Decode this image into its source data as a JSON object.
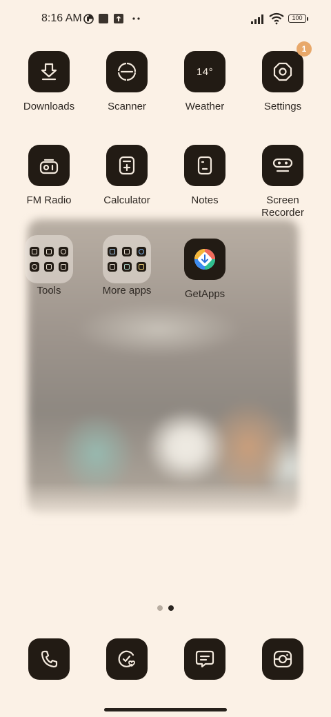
{
  "status_bar": {
    "time": "8:16 AM",
    "battery": "100",
    "icons": [
      "data-saver-icon",
      "square-notification-icon",
      "upload-notification-icon",
      "more-notifications-icon",
      "signal-icon",
      "wifi-icon",
      "battery-icon"
    ]
  },
  "home": {
    "row1": [
      {
        "label": "Downloads",
        "icon": "download-icon"
      },
      {
        "label": "Scanner",
        "icon": "scanner-icon"
      },
      {
        "label": "Weather",
        "icon": "weather-icon",
        "temp": "14°"
      },
      {
        "label": "Settings",
        "icon": "settings-icon",
        "badge": "1"
      }
    ],
    "row2": [
      {
        "label": "FM Radio",
        "icon": "radio-icon"
      },
      {
        "label": "Calculator",
        "icon": "calculator-icon"
      },
      {
        "label": "Notes",
        "icon": "notes-icon"
      },
      {
        "label": "Screen\nRecorder",
        "icon": "screen-recorder-icon"
      }
    ],
    "row3": [
      {
        "label": "Tools",
        "icon": "folder-icon"
      },
      {
        "label": "More apps",
        "icon": "folder-icon"
      },
      {
        "label": "GetApps",
        "icon": "getapps-icon"
      }
    ]
  },
  "page_indicator": {
    "pages": 2,
    "current": 2
  },
  "dock": [
    {
      "name": "phone",
      "icon": "phone-icon"
    },
    {
      "name": "security",
      "icon": "security-icon"
    },
    {
      "name": "messages",
      "icon": "messages-icon"
    },
    {
      "name": "camera",
      "icon": "camera-icon"
    }
  ],
  "colors": {
    "background": "#fbf1e6",
    "tile": "#221b14",
    "badge": "#e8a86a",
    "glyph": "#f3e9dd"
  }
}
